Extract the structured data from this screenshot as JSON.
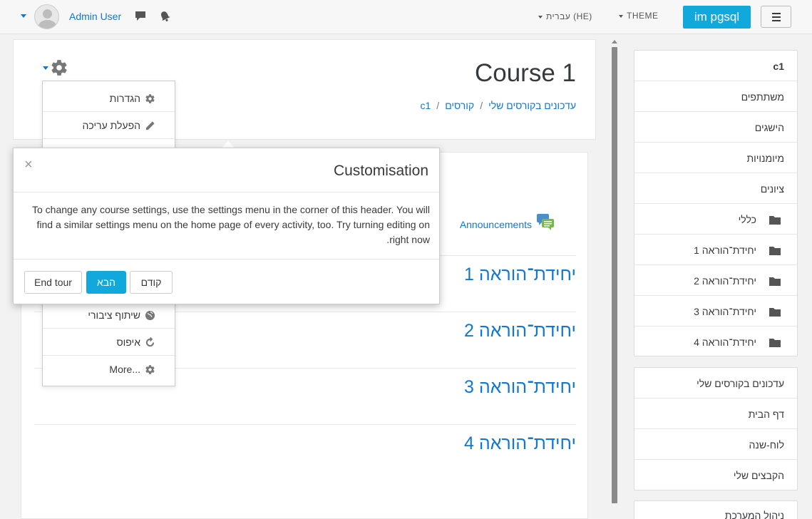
{
  "navbar": {
    "user_name": "Admin User",
    "language": "עברית (HE)",
    "theme": "THEME",
    "site_name": "im pgsql"
  },
  "header": {
    "title": "Course 1",
    "breadcrumb": [
      "עדכונים בקורסים שלי",
      "קורסים",
      "c1"
    ]
  },
  "settings_menu": {
    "items": [
      {
        "label": "הגדרות",
        "icon": "gear-icon"
      },
      {
        "label": "הפעלת עריכה",
        "icon": "pencil-icon"
      },
      {
        "label": "שיתוף ציבורי",
        "icon": "globe-icon"
      },
      {
        "label": "איפוס",
        "icon": "reset-icon"
      },
      {
        "label": "More...",
        "icon": "gear-icon"
      }
    ]
  },
  "tour": {
    "title": "Customisation",
    "close": "×",
    "body": "To change any course settings, use the settings menu in the corner of this header. You will find a similar settings menu on the home page of every activity, too. Try turning editing on right now.",
    "btn_end": "End tour",
    "btn_next": "הבא",
    "btn_prev": "קודם"
  },
  "main": {
    "announcements": "Announcements",
    "sections": [
      "יחידת־הוראה 1",
      "יחידת־הוראה 2",
      "יחידת־הוראה 3",
      "יחידת־הוראה 4"
    ]
  },
  "sidebar": {
    "course_nav": [
      "c1",
      "משתתפים",
      "הישגים",
      "מיומנויות",
      "ציונים"
    ],
    "folders": [
      "כללי",
      "יחידת־הוראה 1",
      "יחידת־הוראה 2",
      "יחידת־הוראה 3",
      "יחידת־הוראה 4"
    ],
    "site_nav": [
      "עדכונים בקורסים שלי",
      "דף הבית",
      "לוח-שנה",
      "הקבצים שלי"
    ],
    "admin": "ניהול המערכת"
  },
  "colors": {
    "accent": "#11a8db",
    "link": "#1177d1"
  }
}
